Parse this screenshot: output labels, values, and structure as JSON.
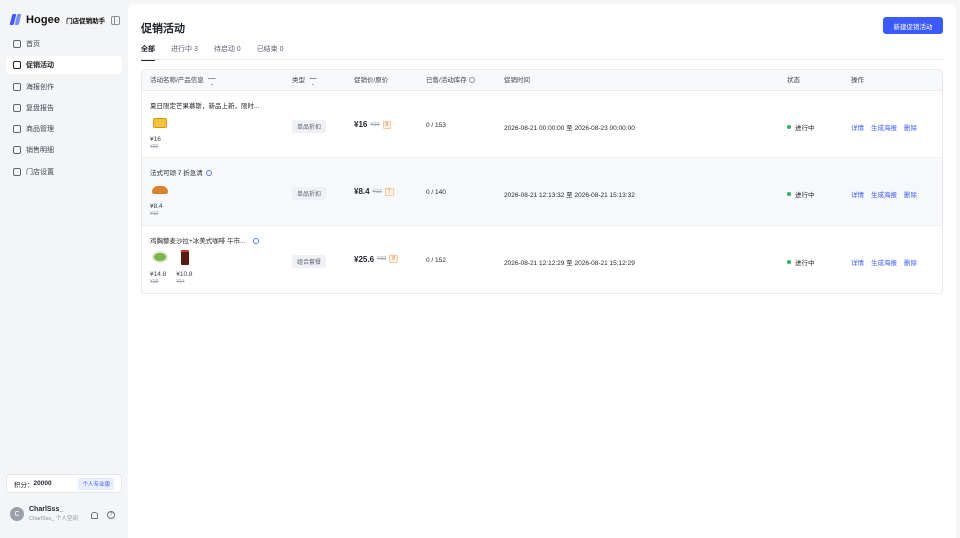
{
  "sidebar": {
    "brand_name": "Hogee",
    "brand_sub": "门店促销助手",
    "items": [
      {
        "label": "首页",
        "icon": "home-icon",
        "active": false
      },
      {
        "label": "促销活动",
        "icon": "gift-icon",
        "active": true
      },
      {
        "label": "海报创作",
        "icon": "image-icon",
        "active": false
      },
      {
        "label": "复盘报告",
        "icon": "report-icon",
        "active": false
      },
      {
        "label": "商品管理",
        "icon": "bag-icon",
        "active": false
      },
      {
        "label": "销售明细",
        "icon": "document-icon",
        "active": false
      },
      {
        "label": "门店设置",
        "icon": "store-icon",
        "active": false
      }
    ],
    "points_label": "积分：",
    "points_value": "20000",
    "plan_badge": "个人专业版",
    "user_initial": "C",
    "user_name": "CharlSss_",
    "user_sub": "CharlSss_ 个人空间"
  },
  "header": {
    "title": "促销活动",
    "new_button": "新建促销活动"
  },
  "tabs": [
    {
      "label": "全部",
      "active": true
    },
    {
      "label": "进行中 3",
      "active": false
    },
    {
      "label": "待启动 0",
      "active": false
    },
    {
      "label": "已结束 0",
      "active": false
    }
  ],
  "table": {
    "columns": {
      "name": "活动名称/产品信息",
      "type": "类型",
      "price": "促销价/原价",
      "sold": "已售/活动库存",
      "period": "促销时间",
      "status": "状态",
      "actions": "操作"
    },
    "rows": [
      {
        "name": "夏日限定芒果慕斯，新品上新，限时...",
        "products": [
          {
            "price": "¥16",
            "old": "¥20"
          }
        ],
        "type": "单品折扣",
        "price_now": "¥16",
        "price_old": "¥20",
        "discount": "8",
        "sold": "0 / 153",
        "period": "2026-08-21 00:00:00 至 2026-08-23 00:00:00",
        "status": "进行中",
        "actions": [
          "详情",
          "生成海报",
          "删除"
        ]
      },
      {
        "name": "法式可颂 7 折急清",
        "products": [
          {
            "price": "¥8.4",
            "old": "¥12"
          }
        ],
        "type": "单品折扣",
        "price_now": "¥8.4",
        "price_old": "¥12",
        "discount": "7",
        "sold": "0 / 140",
        "period": "2026-08-21 12:13:32 至 2026-08-21 15:13:32",
        "status": "进行中",
        "actions": [
          "详情",
          "生成海报",
          "删除"
        ]
      },
      {
        "name": "鸡胸藜麦沙拉+冰美式咖啡 午市...",
        "products": [
          {
            "price": "¥14.8",
            "old": "¥18"
          },
          {
            "price": "¥10.8",
            "old": "¥14"
          }
        ],
        "type": "组合套餐",
        "price_now": "¥25.6",
        "price_old": "¥32",
        "discount": "8",
        "sold": "0 / 152",
        "period": "2026-08-21 12:12:29 至 2026-08-21 15:12:29",
        "status": "进行中",
        "actions": [
          "详情",
          "生成海报",
          "删除"
        ]
      }
    ]
  },
  "colors": {
    "accent": "#3b5bff",
    "status_active": "#2fb36a",
    "discount": "#e07b2a"
  }
}
